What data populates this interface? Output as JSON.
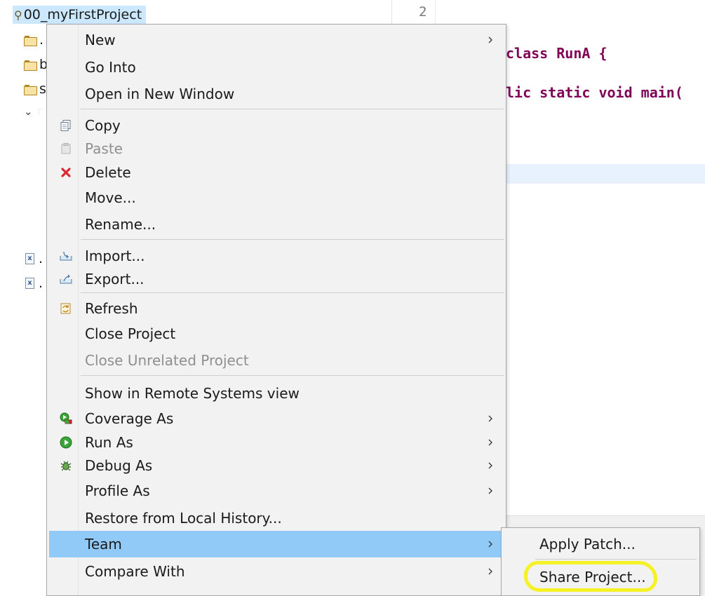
{
  "explorer": {
    "project_name": "00_myFirstProject",
    "tree_rows": [
      {
        "label": ".",
        "icon": "folder-icon"
      },
      {
        "label": "b",
        "icon": "folder-icon"
      },
      {
        "label": "s",
        "icon": "folder-icon"
      },
      {
        "label": "r",
        "icon": "chevron-down-icon"
      },
      {
        "label": ".",
        "icon": "xml-file-icon"
      },
      {
        "label": ".",
        "icon": "xml-file-icon"
      }
    ]
  },
  "editor": {
    "line_number": "2",
    "code_line_1": "class RunA {",
    "code_line_2": "lic static void main("
  },
  "context_menu": {
    "items": [
      {
        "label": "New",
        "submenu": true
      },
      {
        "label": "Go Into"
      },
      {
        "label": "Open in New Window"
      },
      {
        "label": "Copy",
        "icon": "copy-icon"
      },
      {
        "label": "Paste",
        "icon": "paste-icon",
        "disabled": true
      },
      {
        "label": "Delete",
        "icon": "delete-icon"
      },
      {
        "label": "Move..."
      },
      {
        "label": "Rename..."
      },
      {
        "label": "Import...",
        "icon": "import-icon"
      },
      {
        "label": "Export...",
        "icon": "export-icon"
      },
      {
        "label": "Refresh",
        "icon": "refresh-icon"
      },
      {
        "label": "Close Project"
      },
      {
        "label": "Close Unrelated Project",
        "disabled": true
      },
      {
        "label": "Show in Remote Systems view"
      },
      {
        "label": "Coverage As",
        "icon": "coverage-icon",
        "submenu": true
      },
      {
        "label": "Run As",
        "icon": "run-icon",
        "submenu": true
      },
      {
        "label": "Debug As",
        "icon": "debug-icon",
        "submenu": true
      },
      {
        "label": "Profile As",
        "submenu": true
      },
      {
        "label": "Restore from Local History..."
      },
      {
        "label": "Team",
        "submenu": true,
        "highlighted": true
      },
      {
        "label": "Compare With",
        "submenu": true
      }
    ]
  },
  "team_submenu": {
    "items": [
      {
        "label": "Apply Patch..."
      },
      {
        "label": "Share Project..."
      }
    ]
  },
  "colors": {
    "menu_highlight": "#91c9f7",
    "selection": "#cce8ff",
    "annotation_highlighter": "#f5f01a",
    "keyword": "#7f0055",
    "delete_icon": "#d9282f"
  }
}
